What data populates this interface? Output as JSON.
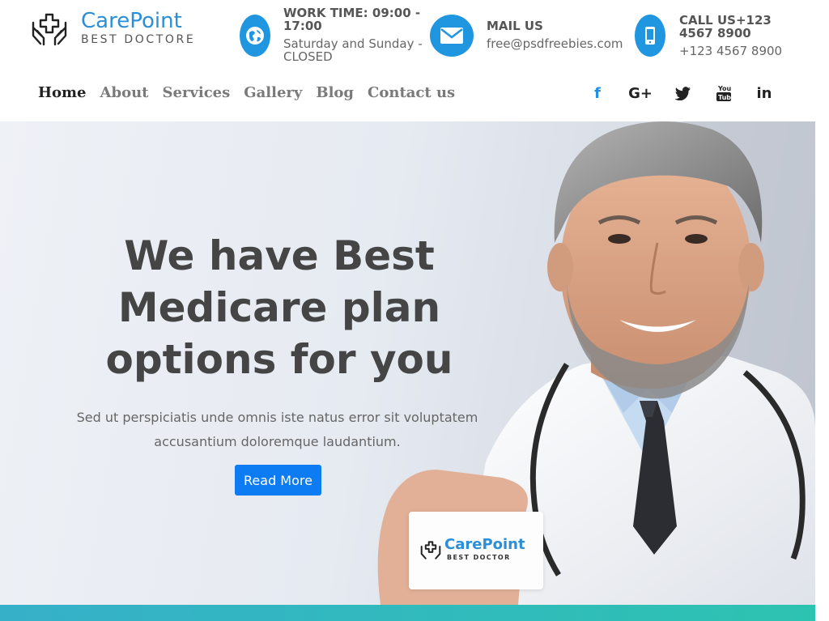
{
  "brand": {
    "name_part1": "Care",
    "name_part2": "Point",
    "tagline": "BEST DOCTORE",
    "accent_color": "#2b8fd8"
  },
  "contact": {
    "work": {
      "title": "WORK TIME: 09:00 - 17:00",
      "detail": "Saturday and Sunday - CLOSED",
      "icon": "globe-icon"
    },
    "mail": {
      "title": "MAIL US",
      "detail": "free@psdfreebies.com",
      "icon": "envelope-icon"
    },
    "call": {
      "title": "CALL US+123 4567 8900",
      "detail": "+123 4567 8900",
      "icon": "phone-icon"
    }
  },
  "nav": {
    "items": [
      "Home",
      "About",
      "Services",
      "Gallery",
      "Blog",
      "Contact us"
    ],
    "active": "Home"
  },
  "social": {
    "facebook": "f",
    "googleplus": "G+",
    "twitter": "twitter-icon",
    "youtube": "youtube-icon",
    "linkedin": "in"
  },
  "hero": {
    "title": "We have Best Medicare plan options for you",
    "text": "Sed ut perspiciatis unde omnis iste natus error sit voluptatem accusantium doloremque laudantium.",
    "button": "Read More",
    "button_color": "#0d7cf2"
  },
  "card": {
    "name_part1": "Care",
    "name_part2": "Point",
    "tagline": "BEST DOCTOR"
  }
}
